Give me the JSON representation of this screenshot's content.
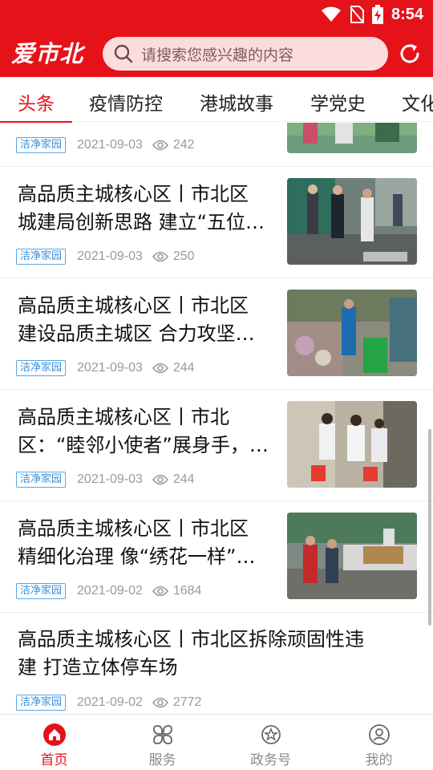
{
  "status_bar": {
    "time": "8:54"
  },
  "header": {
    "logo": "爱市北",
    "search_placeholder": "请搜索您感兴趣的内容"
  },
  "tabs": [
    {
      "label": "头条",
      "active": true
    },
    {
      "label": "疫情防控"
    },
    {
      "label": "港城故事"
    },
    {
      "label": "学党史"
    },
    {
      "label": "文化"
    }
  ],
  "articles": [
    {
      "title": "",
      "tag": "洁净家园",
      "date": "2021-09-03",
      "views": "242"
    },
    {
      "title": "高品质主城核心区丨市北区城建局创新思路 建立“五位…",
      "line1": "高品质主城核心区丨市北区",
      "line2": "城建局创新思路 建立“五位…",
      "tag": "洁净家园",
      "date": "2021-09-03",
      "views": "250"
    },
    {
      "line1": "高品质主城核心区丨市北区",
      "line2": "建设品质主城区 合力攻坚…",
      "tag": "洁净家园",
      "date": "2021-09-03",
      "views": "244"
    },
    {
      "line1": "高品质主城核心区丨市北",
      "line2": "区：“睦邻小使者”展身手，…",
      "tag": "洁净家园",
      "date": "2021-09-03",
      "views": "244"
    },
    {
      "line1": "高品质主城核心区丨市北区",
      "line2": "精细化治理 像“绣花一样”…",
      "tag": "洁净家园",
      "date": "2021-09-02",
      "views": "1684"
    },
    {
      "line1": "高品质主城核心区丨市北区拆除顽固性违",
      "line2": "建 打造立体停车场",
      "tag": "洁净家园",
      "date": "2021-09-02",
      "views": "2772"
    }
  ],
  "bottom_nav": [
    {
      "label": "首页",
      "icon": "home-icon",
      "active": true
    },
    {
      "label": "服务",
      "icon": "services-icon"
    },
    {
      "label": "政务号",
      "icon": "gov-badge-icon"
    },
    {
      "label": "我的",
      "icon": "profile-icon"
    }
  ],
  "colors": {
    "brand": "#e5121a",
    "tag": "#3a8fd8",
    "meta": "#9a9a9a"
  }
}
